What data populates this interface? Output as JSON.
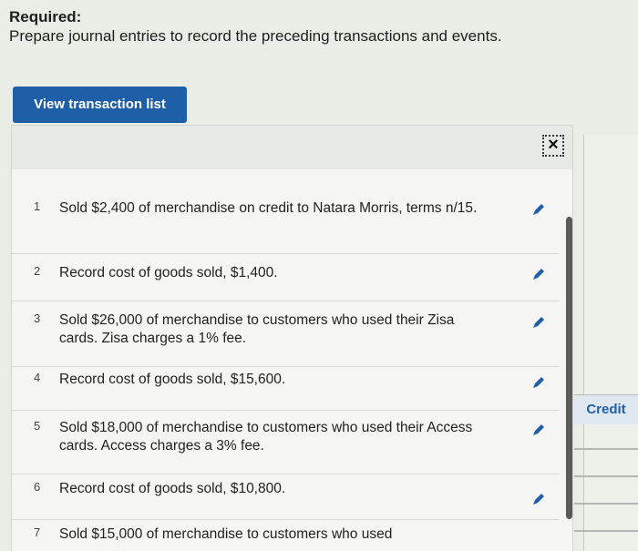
{
  "required": {
    "label": "Required:",
    "instruction": "Prepare journal entries to record the preceding transactions and events."
  },
  "view_button": "View transaction list",
  "close_icon": "close-icon",
  "transactions": [
    {
      "number": "1",
      "text": "Sold $2,400 of merchandise on credit to Natara Morris, terms n/15."
    },
    {
      "number": "2",
      "text": "Record cost of goods sold, $1,400."
    },
    {
      "number": "3",
      "text": "Sold $26,000 of merchandise to customers who used their Zisa cards. Zisa charges a 1% fee."
    },
    {
      "number": "4",
      "text": "Record cost of goods sold, $15,600."
    },
    {
      "number": "5",
      "text": "Sold $18,000 of merchandise to customers who used their Access cards. Access charges a 3% fee."
    },
    {
      "number": "6",
      "text": "Record cost of goods sold, $10,800."
    },
    {
      "number": "7",
      "text": "Sold $15,000 of merchandise to customers who used"
    }
  ],
  "right_column_header": "Credit",
  "colors": {
    "button": "#1f5fa8",
    "edit_icon": "#1f5fa8"
  }
}
